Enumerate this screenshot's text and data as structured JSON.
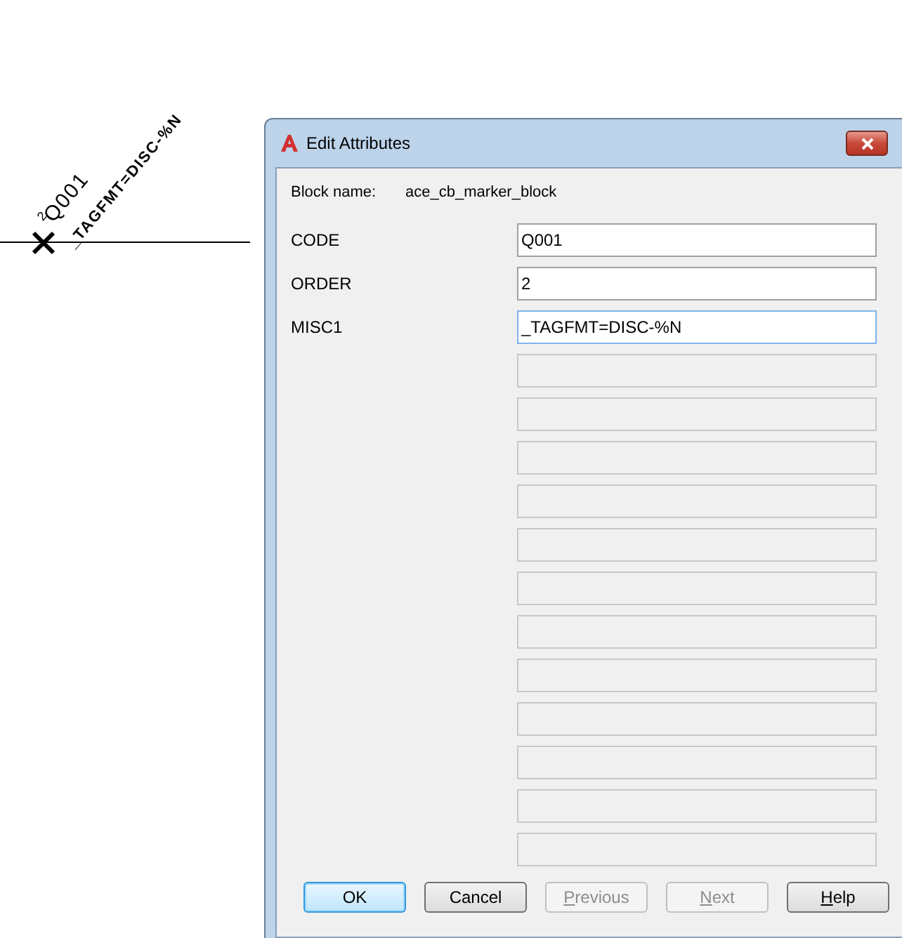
{
  "drawing": {
    "order_text": "2",
    "code_text": "Q001",
    "misc_text": "_TAGFMT=DISC-%N"
  },
  "dialog": {
    "title": "Edit Attributes",
    "block_label": "Block name:",
    "block_name": "ace_cb_marker_block",
    "fields": [
      {
        "label": "CODE",
        "value": "Q001",
        "disabled": false,
        "focused": false
      },
      {
        "label": "ORDER",
        "value": "2",
        "disabled": false,
        "focused": false
      },
      {
        "label": "MISC1",
        "value": "_TAGFMT=DISC-%N",
        "disabled": false,
        "focused": true
      },
      {
        "disabled": true
      },
      {
        "disabled": true
      },
      {
        "disabled": true
      },
      {
        "disabled": true
      },
      {
        "disabled": true
      },
      {
        "disabled": true
      },
      {
        "disabled": true
      },
      {
        "disabled": true
      },
      {
        "disabled": true
      },
      {
        "disabled": true
      },
      {
        "disabled": true
      },
      {
        "disabled": true
      }
    ],
    "buttons": [
      {
        "label": "OK",
        "default": true,
        "disabled": false,
        "underline_first": false
      },
      {
        "label": "Cancel",
        "default": false,
        "disabled": false,
        "underline_first": false
      },
      {
        "label": "Previous",
        "default": false,
        "disabled": true,
        "underline_first": true
      },
      {
        "label": "Next",
        "default": false,
        "disabled": true,
        "underline_first": true
      },
      {
        "label": "Help",
        "default": false,
        "disabled": false,
        "underline_first": true
      }
    ]
  }
}
